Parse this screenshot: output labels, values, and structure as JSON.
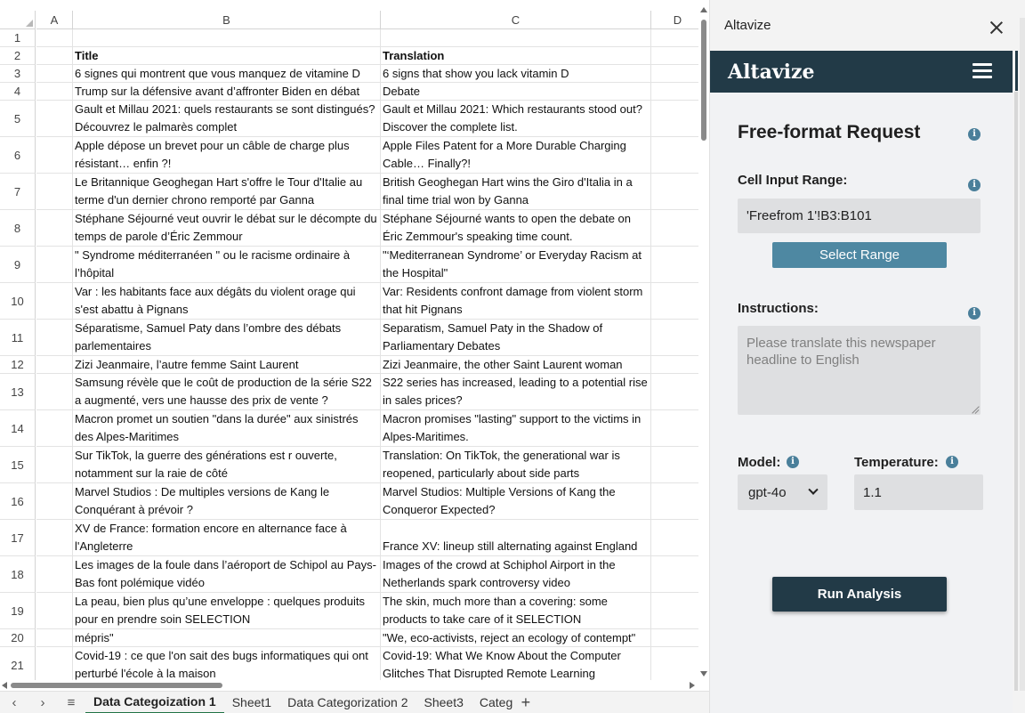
{
  "sheet": {
    "columns": [
      "A",
      "B",
      "C",
      "D"
    ],
    "rows": [
      {
        "num": "1",
        "b": "",
        "c": ""
      },
      {
        "num": "2",
        "b": "Title",
        "c": "Translation"
      },
      {
        "num": "3",
        "b": "6 signes qui montrent que vous manquez de vitamine D",
        "c": "6 signs that show you lack vitamin D"
      },
      {
        "num": "4",
        "b": "Trump sur la défensive avant d’affronter Biden en débat",
        "c": "Debate"
      },
      {
        "num": "5",
        "b": "Gault et Millau 2021: quels restaurants se sont distingués? Découvrez le palmarès complet",
        "c": "Gault et Millau 2021: Which restaurants stood out? Discover the complete list."
      },
      {
        "num": "6",
        "b": "Apple dépose un brevet pour un câble de charge plus résistant… enfin ?!",
        "c": "Apple Files Patent for a More Durable Charging Cable… Finally?!"
      },
      {
        "num": "7",
        "b": "Le Britannique Geoghegan Hart s'offre le Tour d'Italie au terme d'un dernier chrono remporté par Ganna",
        "c": "British Geoghegan Hart wins the Giro d'Italia in a final time trial won by Ganna"
      },
      {
        "num": "8",
        "b": "Stéphane Séjourné veut ouvrir le débat sur le décompte du temps de parole d’Éric Zemmour",
        "c": "Stéphane Séjourné wants to open the debate on Éric Zemmour's speaking time count."
      },
      {
        "num": "9",
        "b": "\" Syndrome méditerranéen \" ou le racisme ordinaire à l’hôpital",
        "c": "\"‘Mediterranean Syndrome’ or Everyday Racism at the Hospital\""
      },
      {
        "num": "10",
        "b": "Var : les habitants face aux dégâts du violent orage qui s'est abattu à Pignans",
        "c": "Var: Residents confront damage from violent storm that hit Pignans"
      },
      {
        "num": "11",
        "b": "Séparatisme, Samuel Paty dans l’ombre des débats parlementaires",
        "c": "Separatism, Samuel Paty in the Shadow of Parliamentary Debates"
      },
      {
        "num": "12",
        "b": "Zizi Jeanmaire, l’autre femme Saint Laurent",
        "c": "Zizi Jeanmaire, the other Saint Laurent woman"
      },
      {
        "num": "13",
        "b": "Samsung révèle que le coût de production de la série S22 a augmenté, vers une hausse des prix de vente ?",
        "c": "S22 series has increased, leading to a potential rise in sales prices?"
      },
      {
        "num": "14",
        "b": "Macron promet un soutien \"dans la durée\" aux sinistrés des Alpes-Maritimes",
        "c": "Macron promises \"lasting\" support to the victims in Alpes-Maritimes."
      },
      {
        "num": "15",
        "b": "Sur TikTok, la guerre des générations est r ouverte, notamment sur la raie de côté",
        "c": "Translation: On TikTok, the generational war is reopened, particularly about side parts"
      },
      {
        "num": "16",
        "b": "Marvel Studios : De multiples versions de Kang le Conquérant à prévoir ?",
        "c": "Marvel Studios: Multiple Versions of Kang the Conqueror Expected?"
      },
      {
        "num": "17",
        "b": "XV de France: formation encore en alternance face à l'Angleterre",
        "c": "France XV: lineup still alternating against England"
      },
      {
        "num": "18",
        "b": "Les images de la foule dans l’aéroport de Schipol au Pays-Bas font polémique vidéo",
        "c": "Images of the crowd at Schiphol Airport in the Netherlands spark controversy video"
      },
      {
        "num": "19",
        "b": "La peau, bien plus qu’une enveloppe : quelques produits pour en prendre soin SELECTION",
        "c": "The skin, much more than a covering: some products to take care of it SELECTION"
      },
      {
        "num": "20",
        "b": "mépris\"",
        "c": "\"We, eco-activists, reject an ecology of contempt\""
      },
      {
        "num": "21",
        "b": "Covid-19 : ce que l'on sait des bugs informatiques qui ont perturbé l'école à la maison",
        "c": "Covid-19: What We Know About the Computer Glitches That Disrupted Remote Learning"
      }
    ],
    "tabs": [
      "Data Categoization 1",
      "Sheet1",
      "Data Categorization 2",
      "Sheet3",
      "Catego"
    ],
    "active_tab": "Data Categoization 1",
    "nav_prev": "‹",
    "nav_next": "›",
    "nav_menu": "≡",
    "add_sheet": "+"
  },
  "pane": {
    "title": "Altavize",
    "brand": "Altavize",
    "request_title": "Free-format Request",
    "cell_input_label": "Cell Input Range:",
    "cell_input_value": "'Freefrom 1'!B3:B101",
    "select_range_label": "Select Range",
    "instructions_label": "Instructions:",
    "instructions_placeholder": "Please translate this newspaper headline to English",
    "model_label": "Model:",
    "model_value": "gpt-4o",
    "temperature_label": "Temperature:",
    "temperature_value": "1.1",
    "run_label": "Run Analysis",
    "info_glyph": "i"
  },
  "colors": {
    "header_bg": "#223a47",
    "button_secondary": "#4e88a2",
    "info_icon": "#4a7f9a",
    "active_tab_underline": "#217346"
  }
}
